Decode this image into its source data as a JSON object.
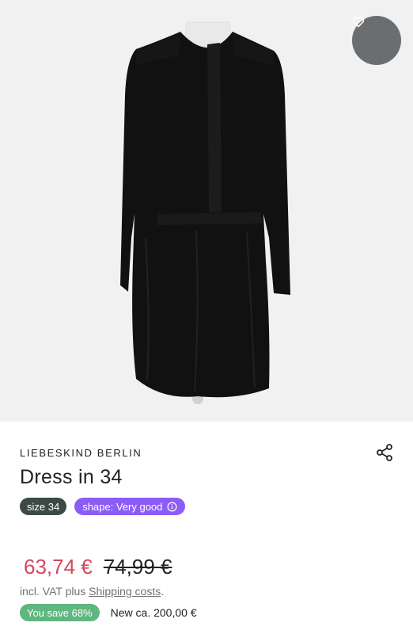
{
  "product": {
    "brand": "LIEBESKIND BERLIN",
    "title": "Dress in 34",
    "image_icon": "product-photo-black-dress",
    "size_badge": "size 34",
    "shape_badge": "shape: Very good",
    "price_now": "63,74 €",
    "price_old": "74,99 €",
    "vat_prefix": "incl. VAT plus ",
    "shipping_link": "Shipping costs",
    "vat_suffix": ".",
    "save_badge": "You save 68%",
    "new_price": "New ca. 200,00 €"
  },
  "icons": {
    "favorite": "heart-icon",
    "share": "share-icon",
    "info": "info-icon"
  },
  "colors": {
    "sale_price": "#d4475b",
    "size_badge": "#3d4a43",
    "shape_badge": "#8b5cf6",
    "save_badge": "#5fb67f",
    "favorite_button": "#6b6e70"
  }
}
